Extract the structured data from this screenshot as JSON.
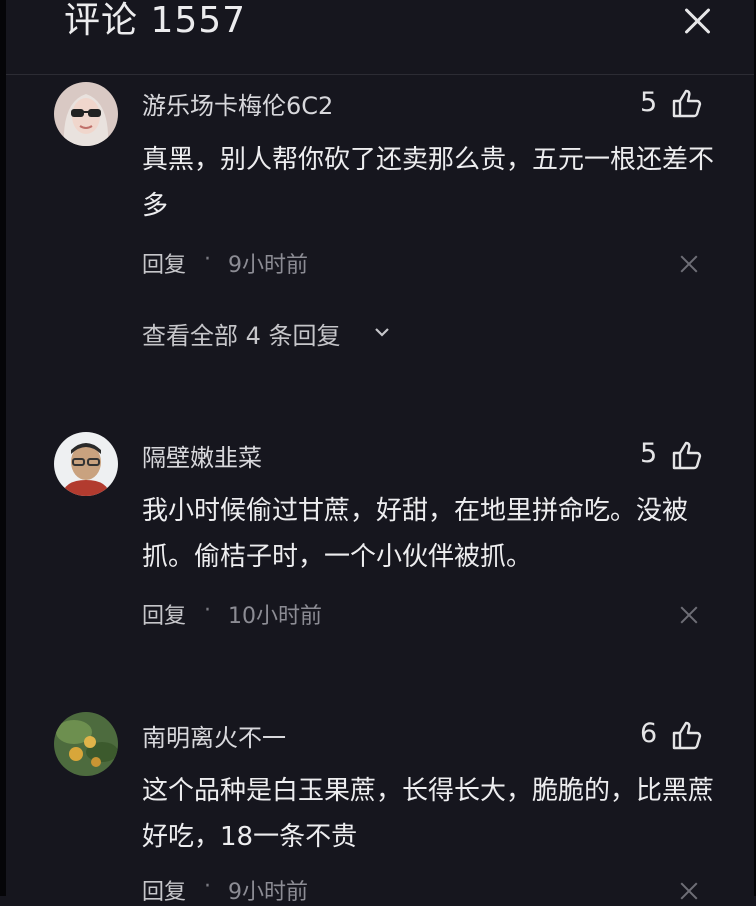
{
  "header": {
    "title": "评论 1557"
  },
  "comments": [
    {
      "username": "游乐场卡梅伦6C2",
      "likes": "5",
      "text": "真黑，别人帮你砍了还卖那么贵，五元一根还差不多",
      "reply_label": "回复",
      "separator": "·",
      "time": "9小时前",
      "view_all": "查看全部 4 条回复"
    },
    {
      "username": "隔壁嫩韭菜",
      "likes": "5",
      "text": "我小时候偷过甘蔗，好甜，在地里拼命吃。没被抓。偷桔子时，一个小伙伴被抓。",
      "reply_label": "回复",
      "separator": "·",
      "time": "10小时前"
    },
    {
      "username": "南明离火不一",
      "likes": "6",
      "text": "这个品种是白玉果蔗，长得长大，脆脆的，比黑蔗好吃，18一条不贵",
      "reply_label": "回复",
      "separator": "·",
      "time": "9小时前"
    }
  ]
}
